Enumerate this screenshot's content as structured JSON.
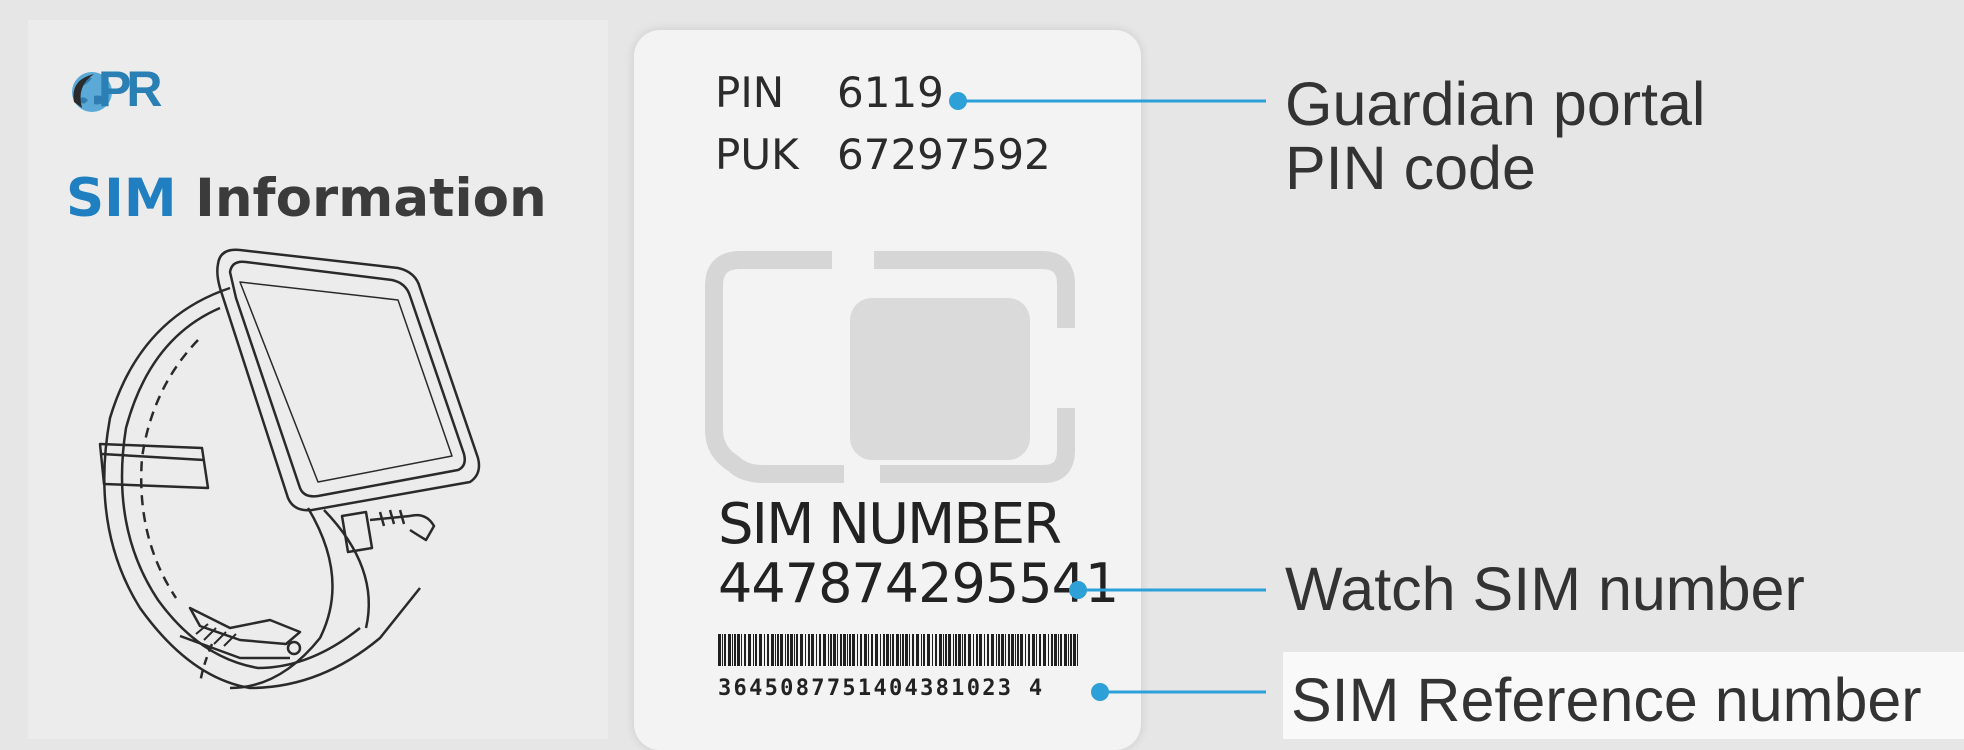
{
  "logo": {
    "text": "PR"
  },
  "title": {
    "sim": "SIM",
    "info": "Information"
  },
  "card": {
    "pin_label": "PIN",
    "pin_value": "6119",
    "puk_label": "PUK",
    "puk_value": "67297592",
    "sim_number_label": "SIM NUMBER",
    "sim_number_value": "447874295541",
    "reference_value": "3645087751404381023 4"
  },
  "callouts": {
    "pin_line1": "Guardian portal",
    "pin_line2": "PIN code",
    "watch_sim": "Watch SIM number",
    "reference": "SIM Reference number"
  },
  "colors": {
    "accent": "#2ea0d8",
    "title_blue": "#1f7fc1",
    "text_dark": "#333333"
  }
}
